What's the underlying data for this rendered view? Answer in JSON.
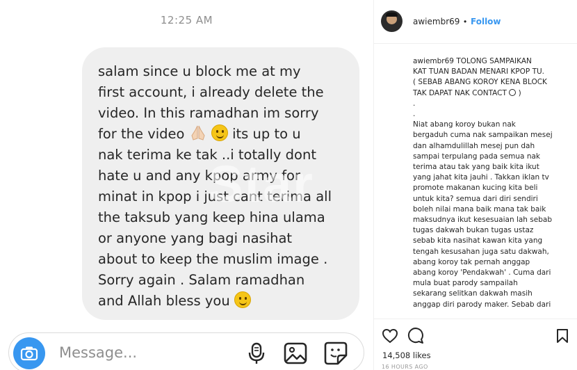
{
  "dm": {
    "timestamp": "12:25 AM",
    "message_lines": [
      "salam since u block me at my",
      "first account, i already delete the",
      "video.   In this ramadhan im sorry",
      "for the video",
      "its up to u",
      "nak terima ke tak ..i totally dont",
      "hate u and any kpop army for",
      "minat in kpop i just cant terima all",
      "the taksub yang keep hina ulama",
      "or anyone yang bagi nasihat",
      "about to keep the muslim image .",
      "Sorry again . Salam ramadhan",
      "and Allah bless you"
    ],
    "watermark": "Star",
    "composer": {
      "placeholder": "Message..."
    },
    "icons": [
      "camera-icon",
      "microphone-icon",
      "image-icon",
      "sticker-icon"
    ],
    "accent_color": "#3897f0",
    "bubble_color": "#efefef"
  },
  "post": {
    "username": "awiembr69",
    "separator": "•",
    "follow_label": "Follow",
    "caption_user": "awiembr69",
    "caption_lines": [
      "TOLONG SAMPAIKAN",
      "KAT TUAN BADAN MENARI KPOP TU.",
      "( SEBAB ABANG KOROY KENA BLOCK",
      "TAK DAPAT NAK CONTACT",
      ")",
      ".",
      ".",
      "Niat abang koroy bukan nak",
      "bergaduh cuma nak sampaikan mesej",
      "dan alhamdulillah mesej pun dah",
      "sampai terpulang pada semua nak",
      "terima atau tak yang baik kita ikut",
      "yang jahat kita jauhi . Takkan iklan tv",
      "promote makanan kucing kita beli",
      "untuk kita? semua dari diri sendiri",
      "boleh nilai mana baik mana tak baik",
      "maksudnya ikut kesesuaian lah sebab",
      "tugas dakwah bukan tugas ustaz",
      "sebab kita nasihat kawan kita yang",
      "tengah kesusahan juga satu dakwah,",
      "abang koroy tak pernah anggap",
      "abang koroy 'Pendakwah' . Cuma dari",
      "mula buat parody sampailah",
      "sekarang selitkan dakwah masih",
      "anggap diri parody maker. Sebab dari"
    ],
    "likes": "14,508 likes",
    "time_ago": "16 HOURS AGO",
    "icons": [
      "heart-icon",
      "comment-icon",
      "bookmark-icon"
    ],
    "link_color": "#3897f0"
  }
}
